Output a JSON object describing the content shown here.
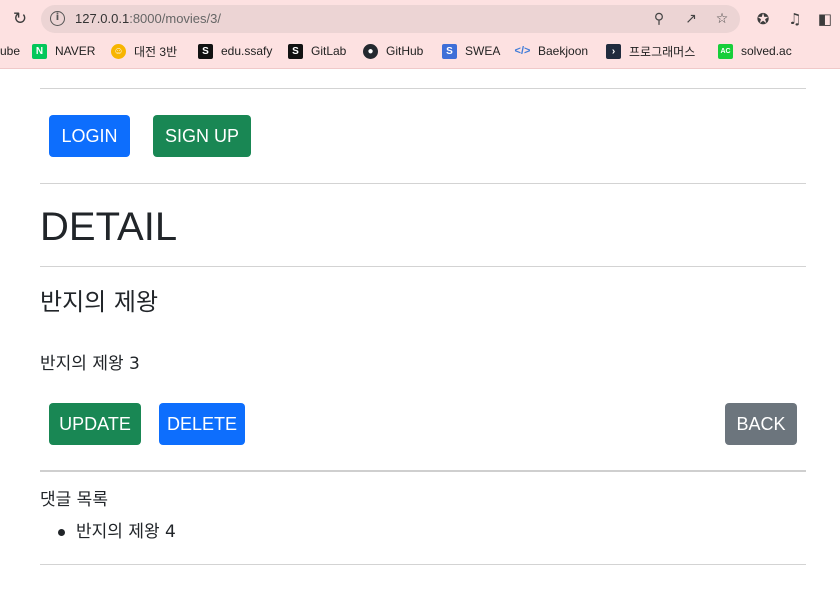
{
  "browser": {
    "url_host": "127.0.0.1",
    "url_rest": ":8000/movies/3/",
    "bookmarks": [
      {
        "label": "ube",
        "icon": "youtube-icon"
      },
      {
        "label": "NAVER",
        "icon": "naver-icon"
      },
      {
        "label": "대전 3반",
        "icon": "emoji-icon"
      },
      {
        "label": "edu.ssafy",
        "icon": "ssafy-icon"
      },
      {
        "label": "GitLab",
        "icon": "gitlab-icon"
      },
      {
        "label": "GitHub",
        "icon": "github-icon"
      },
      {
        "label": "SWEA",
        "icon": "swea-icon"
      },
      {
        "label": "Baekjoon",
        "icon": "baekjoon-icon"
      },
      {
        "label": "프로그래머스",
        "icon": "programmers-icon"
      },
      {
        "label": "solved.ac",
        "icon": "solvedac-icon"
      }
    ]
  },
  "nav": {
    "login_label": "LOGIN",
    "signup_label": "SIGN UP"
  },
  "detail": {
    "heading": "DETAIL",
    "title": "반지의 제왕",
    "content": "반지의 제왕 3",
    "update_label": "UPDATE",
    "delete_label": "DELETE",
    "back_label": "BACK"
  },
  "comments": {
    "heading": "댓글 목록",
    "items": [
      "반지의 제왕 4"
    ]
  },
  "colors": {
    "primary": "#0d6efd",
    "success": "#198754",
    "secondary": "#6c757d"
  }
}
